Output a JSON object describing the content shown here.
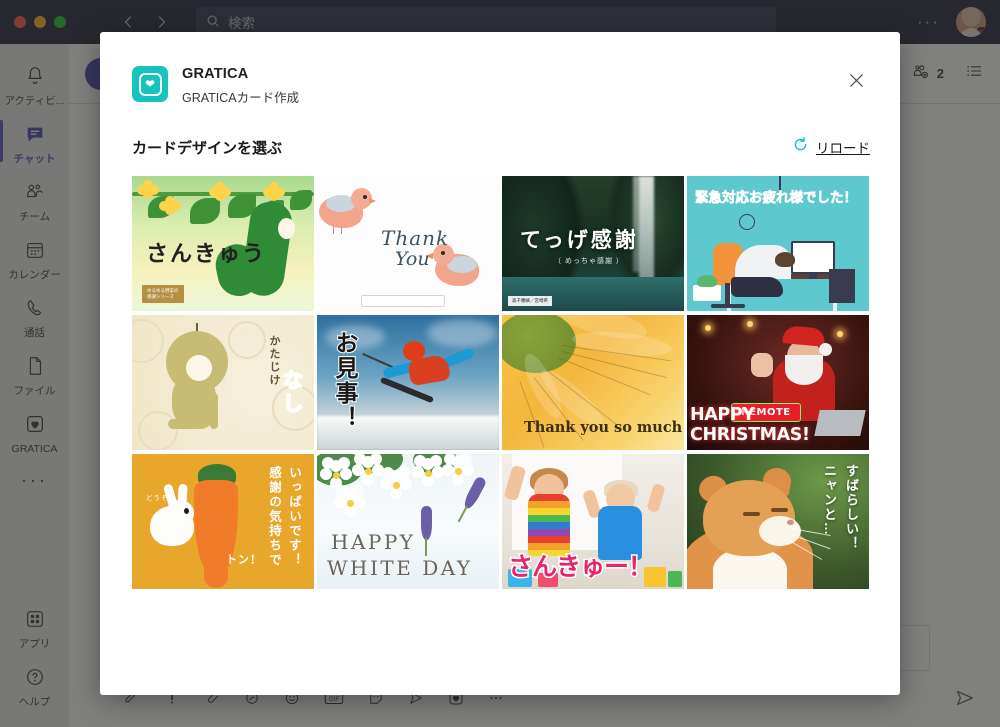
{
  "window": {
    "search_placeholder": "検索",
    "search_value": "",
    "nav_back": "back-arrow",
    "nav_forward": "forward-arrow",
    "more_label": "···"
  },
  "rail": {
    "items": [
      {
        "label": "アクティビ...",
        "icon": "bell-icon",
        "active": false
      },
      {
        "label": "チャット",
        "icon": "chat-icon",
        "active": true
      },
      {
        "label": "チーム",
        "icon": "teams-icon",
        "active": false
      },
      {
        "label": "カレンダー",
        "icon": "calendar-icon",
        "active": false
      },
      {
        "label": "通話",
        "icon": "phone-icon",
        "active": false
      },
      {
        "label": "ファイル",
        "icon": "file-icon",
        "active": false
      },
      {
        "label": "GRATICA",
        "icon": "gratica-heart-icon",
        "active": false
      }
    ],
    "more": "···",
    "bottom": [
      {
        "label": "アプリ",
        "icon": "apps-grid-icon"
      },
      {
        "label": "ヘルプ",
        "icon": "help-question-icon"
      }
    ]
  },
  "chat_header": {
    "people_count": "2",
    "people_icon": "add-people-icon",
    "list_icon": "list-icon"
  },
  "compose": {
    "icons": [
      "format-icon",
      "important-icon",
      "attach-icon",
      "loop-icon",
      "emoji-icon",
      "gif-icon",
      "sticker-icon",
      "praise-icon",
      "gratica-icon",
      "more-icon"
    ],
    "send_icon": "send-icon"
  },
  "modal": {
    "app_name": "GRATICA",
    "app_subtitle": "GRATICAカード作成",
    "app_logo_icon": "gratica-heart-logo",
    "close_icon": "close-icon",
    "section_title": "カードデザインを選ぶ",
    "reload_label": "リロード",
    "reload_icon": "reload-icon",
    "accent_color": "#14c4bd"
  },
  "cards": [
    {
      "id": "card-cucumber",
      "text": "さんきゅう",
      "badge": "ゆるゆる野菜の\n感謝シリーズ",
      "alt": "きゅうりのイラスト"
    },
    {
      "id": "card-thankyou-birds",
      "line1": "Thank",
      "line2": "You",
      "alt": "水彩の小鳥 Thank You"
    },
    {
      "id": "card-waterfall",
      "text": "てっげ感謝",
      "sub": "（ めっちゃ感謝 ）",
      "badge": "高千穂峡／宮崎県",
      "alt": "滝の写真"
    },
    {
      "id": "card-overtime",
      "text": "緊急対応お疲れ様でした！",
      "alt": "デスクで伏せる人のイラスト"
    },
    {
      "id": "card-pear",
      "line1": "かたじけ",
      "line2": "なし",
      "alt": "梨のキャラクター"
    },
    {
      "id": "card-ski",
      "text": "お見事！",
      "alt": "スキーヤーの写真"
    },
    {
      "id": "card-sunflower",
      "text": "Thank you so much",
      "alt": "ひまわりの写真"
    },
    {
      "id": "card-santa",
      "badge": "REMOTE",
      "text": "HAPPY CHRISTMAS!",
      "alt": "サンタの写真"
    },
    {
      "id": "card-rabbit",
      "line1": "感謝の気持ちで",
      "line2": "いっぱいです！",
      "small": "どうぞ",
      "small2": "トン！",
      "alt": "うさぎとにんじん"
    },
    {
      "id": "card-whiteday",
      "line1": "HAPPY",
      "line2": "WHITE DAY",
      "alt": "白い花の写真"
    },
    {
      "id": "card-kids",
      "text": "さんきゅー！",
      "alt": "喜ぶ子供たちの写真"
    },
    {
      "id": "card-cat",
      "line1": "ニャンと…",
      "line2": "すばらしい！",
      "alt": "猫の写真"
    }
  ]
}
